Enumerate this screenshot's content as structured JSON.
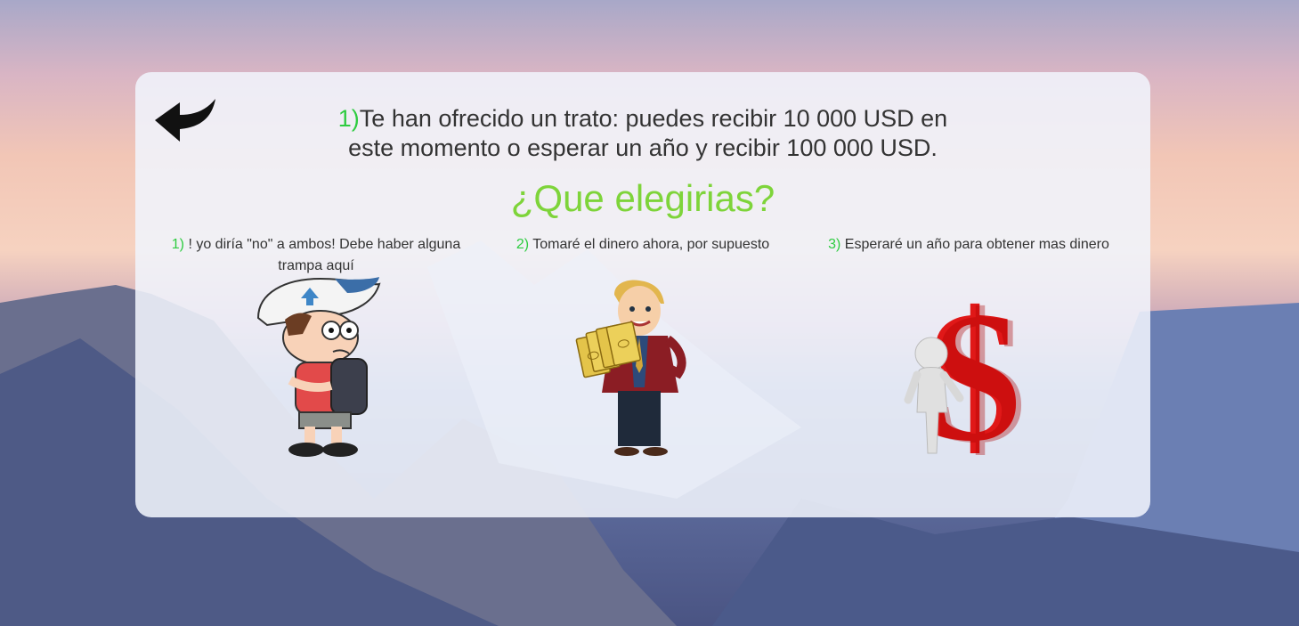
{
  "background": {
    "sky_top": "#a8a8c8",
    "sky_warm": "#f2c6b6",
    "mountain": "#5d6b9c"
  },
  "colors": {
    "accent_green": "#2ecc40",
    "subtitle_green": "#7ed43a",
    "text": "#333333"
  },
  "back_button": {
    "icon": "back-arrow-icon"
  },
  "question": {
    "number": "1)",
    "line1": "Te han ofrecido un trato: puedes recibir 10 000 USD en",
    "line2": "este momento o esperar un año y recibir 100 000 USD."
  },
  "subtitle": "¿Que elegirias?",
  "options": [
    {
      "number": "1)",
      "label": " ! yo diría \"no\" a ambos! Debe haber alguna trampa aquí",
      "image": "confused-boy-icon"
    },
    {
      "number": "2)",
      "label": " Tomaré el dinero ahora, por supuesto",
      "image": "man-with-money-icon"
    },
    {
      "number": "3)",
      "label": " Esperaré un año para obtener mas dinero",
      "image": "dollar-sign-figure-icon"
    }
  ]
}
